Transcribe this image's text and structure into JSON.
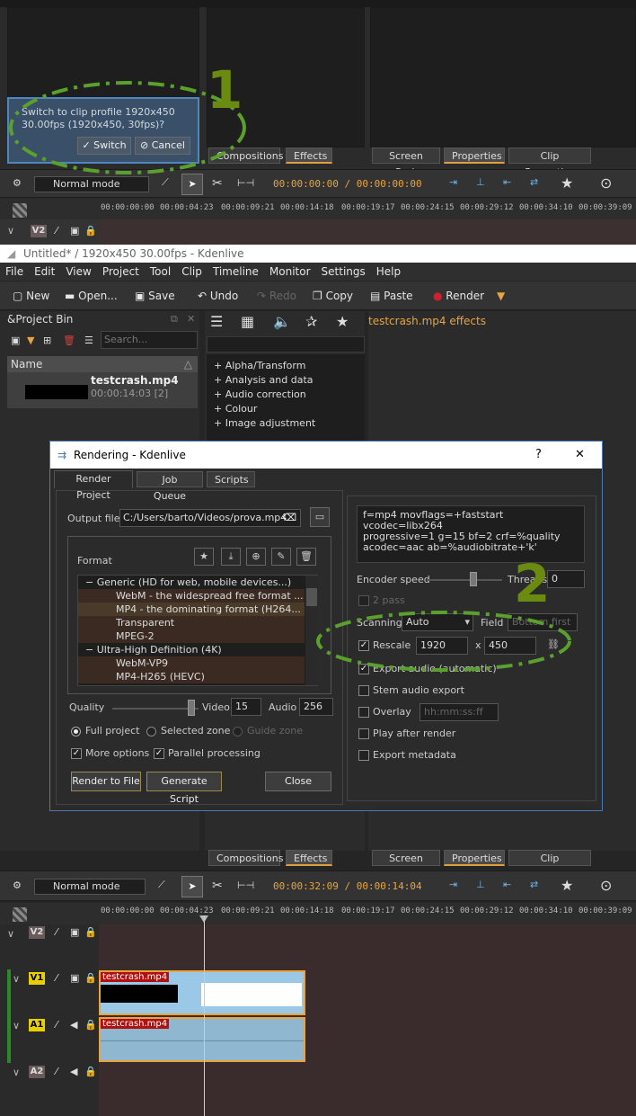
{
  "top": {
    "popup": {
      "line1": "Switch to clip profile 1920x450",
      "line2": "30.00fps (1920x450, 30fps)?",
      "switch": "Switch",
      "cancel": "Cancel"
    },
    "tabs_left": [
      "Compositions",
      "Effects"
    ],
    "tabs_right": [
      "Screen Grab",
      "Properties",
      "Clip Properties"
    ],
    "mode": "Normal mode",
    "timecode": "00:00:00:00 / 00:00:00:00",
    "ruler": [
      "00:00:00:00",
      "00:00:04:23",
      "00:00:09:21",
      "00:00:14:18",
      "00:00:19:17",
      "00:00:24:15",
      "00:00:29:12",
      "00:00:34:10",
      "00:00:39:09"
    ],
    "track": "V2",
    "callout": "1"
  },
  "window_title": "Untitled* / 1920x450 30.00fps - Kdenlive",
  "menu": [
    "File",
    "Edit",
    "View",
    "Project",
    "Tool",
    "Clip",
    "Timeline",
    "Monitor",
    "Settings",
    "Help"
  ],
  "toolbar": {
    "new": "New",
    "open": "Open...",
    "save": "Save",
    "undo": "Undo",
    "redo": "Redo",
    "copy": "Copy",
    "paste": "Paste",
    "render": "Render"
  },
  "bin": {
    "title": "&Project Bin",
    "search": "Search...",
    "col_name": "Name",
    "clip_name": "testcrash.mp4",
    "clip_info": "00:00:14:03 [2]"
  },
  "effects": {
    "title": "testcrash.mp4 effects",
    "categories": [
      "Alpha/Transform",
      "Analysis and data",
      "Audio correction",
      "Colour",
      "Image adjustment"
    ]
  },
  "dialog": {
    "title": "Rendering - Kdenlive",
    "help": "?",
    "close_x": "✕",
    "tabs": [
      "Render Project",
      "Job Queue",
      "Scripts"
    ],
    "output_label": "Output file",
    "output_value": "C:/Users/barto/Videos/prova.mp4",
    "format_label": "Format",
    "formats": [
      {
        "text": "Generic (HD for web, mobile devices...)",
        "level": 0,
        "sel": false
      },
      {
        "text": "WebM - the widespread free format ...",
        "level": 1,
        "sel": false
      },
      {
        "text": "MP4 - the dominating format (H264...",
        "level": 1,
        "sel": true
      },
      {
        "text": "Transparent",
        "level": 1,
        "sel": false
      },
      {
        "text": "MPEG-2",
        "level": 1,
        "sel": false
      },
      {
        "text": "Ultra-High Definition (4K)",
        "level": 0,
        "sel": false
      },
      {
        "text": "WebM-VP9",
        "level": 1,
        "sel": false
      },
      {
        "text": "MP4-H265 (HEVC)",
        "level": 1,
        "sel": false
      }
    ],
    "quality": "Quality",
    "video": "Video",
    "video_val": "15",
    "audio": "Audio",
    "audio_val": "256",
    "full_project": "Full project",
    "selected_zone": "Selected zone",
    "guide_zone": "Guide zone",
    "more_options": "More options",
    "parallel": "Parallel processing",
    "render_file": "Render to File",
    "gen_script": "Generate Script",
    "close": "Close",
    "params": [
      "f=mp4 movflags=+faststart vcodec=libx264",
      "progressive=1 g=15 bf=2 crf=%quality",
      "acodec=aac ab=%audiobitrate+'k'"
    ],
    "encoder_speed": "Encoder speed",
    "threads": "Threads",
    "threads_val": "0",
    "two_pass": "2 pass",
    "scanning": "Scanning",
    "scanning_val": "Auto",
    "field": "Field",
    "field_val": "Bottom first",
    "rescale": "Rescale",
    "rescale_w": "1920",
    "x": "x",
    "rescale_h": "450",
    "export_audio": "Export audio (automatic)",
    "stem": "Stem audio export",
    "overlay": "Overlay",
    "overlay_val": "hh:mm:ss:ff",
    "play_after": "Play after render",
    "export_meta": "Export metadata"
  },
  "callout2": "2",
  "bottom": {
    "tabs_left": [
      "Compositions",
      "Effects"
    ],
    "tabs_right": [
      "Screen Grab",
      "Properties",
      "Clip Properties"
    ],
    "mode": "Normal mode",
    "timecode": "00:00:32:09 / 00:00:14:04",
    "ruler": [
      "00:00:00:00",
      "00:00:04:23",
      "00:00:09:21",
      "00:00:14:18",
      "00:00:19:17",
      "00:00:24:15",
      "00:00:29:12",
      "00:00:34:10",
      "00:00:39:09"
    ],
    "tracks": [
      "V2",
      "V1",
      "A1",
      "A2"
    ],
    "clip_label": "testcrash.mp4"
  },
  "colors": {
    "accent": "#e8a440",
    "callout": "#5aa02c",
    "track_v": "#e8d000",
    "selection": "#4a3a2a"
  }
}
